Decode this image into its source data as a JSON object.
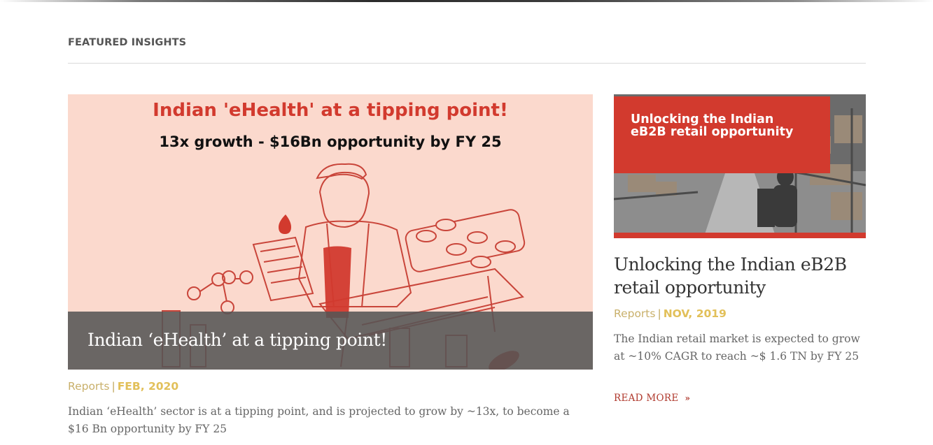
{
  "section": {
    "title": "FEATURED INSIGHTS"
  },
  "featured": {
    "image_headline": "Indian 'eHealth' at a tipping point!",
    "image_subheadline": "13x growth - $16Bn opportunity by FY 25",
    "caption": "Indian ‘eHealth’ at a tipping point!",
    "category": "Reports",
    "separator": "|",
    "date": "FEB, 2020",
    "excerpt": "Indian ‘eHealth’ sector is at a tipping point, and is projected to grow by ~13x, to become a $16 Bn opportunity by FY 25"
  },
  "side": {
    "image_text": "Unlocking the Indian eB2B retail opportunity",
    "title": "Unlocking the Indian eB2B retail opportunity",
    "category": "Reports",
    "separator": "|",
    "date": "NOV, 2019",
    "excerpt": "The Indian retail market is expected to grow at ~10% CAGR to reach ~$ 1.6 TN by FY 25",
    "read_more": "READ MORE",
    "read_more_icon": "»"
  },
  "colors": {
    "accent_red": "#d23a2e",
    "hero_bg": "#fbd9cd",
    "meta_gold": "#e2c05a",
    "link_red": "#b03a2e"
  }
}
